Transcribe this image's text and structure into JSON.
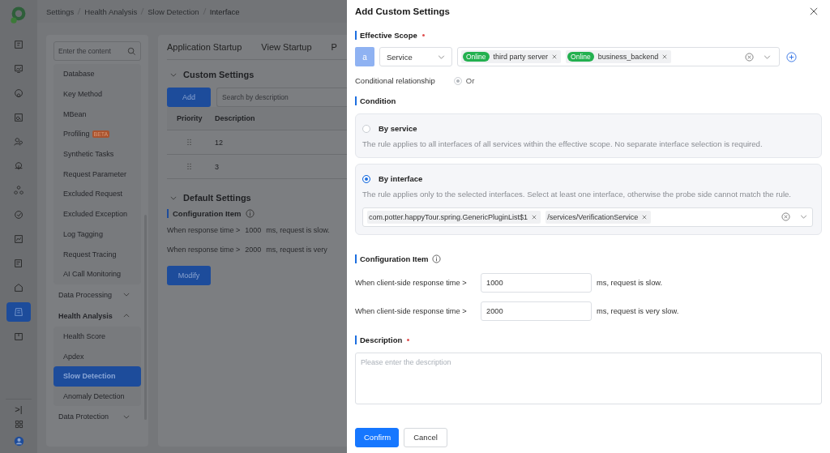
{
  "rail": {
    "icons": [
      {
        "selected": false
      },
      {
        "selected": false
      },
      {
        "selected": false
      },
      {
        "selected": false
      },
      {
        "selected": false
      },
      {
        "selected": false
      },
      {
        "selected": false
      },
      {
        "selected": false
      },
      {
        "selected": false
      },
      {
        "selected": false
      },
      {
        "selected": false
      },
      {
        "selected": true
      },
      {
        "selected": false
      }
    ],
    "collapse": ">|"
  },
  "breadcrumb": [
    "Settings",
    "Health Analysis",
    "Slow Detection",
    "Interface"
  ],
  "sidebar": {
    "search": {
      "placeholder": "Enter the content"
    },
    "items": [
      {
        "label": "Database",
        "selected": false
      },
      {
        "label": "Key Method",
        "selected": false
      },
      {
        "label": "MBean",
        "selected": false
      },
      {
        "label": "Profiling",
        "badge": "BETA",
        "selected": false
      },
      {
        "label": "Synthetic Tasks",
        "selected": false
      },
      {
        "label": "Request Parameter",
        "selected": false
      },
      {
        "label": "Excluded Request",
        "selected": false
      },
      {
        "label": "Excluded Exception",
        "selected": false
      },
      {
        "label": "Log Tagging",
        "selected": false
      },
      {
        "label": "Request Tracing",
        "selected": false
      },
      {
        "label": "AI Call Monitoring",
        "selected": false
      }
    ],
    "groups": [
      {
        "label": "Data Processing",
        "expanded": false
      },
      {
        "label": "Health Analysis",
        "expanded": true,
        "children": [
          {
            "label": "Health Score",
            "selected": false
          },
          {
            "label": "Apdex",
            "selected": false
          },
          {
            "label": "Slow Detection",
            "selected": true
          },
          {
            "label": "Anomaly Detection",
            "selected": false
          }
        ]
      },
      {
        "label": "Data Protection",
        "expanded": false
      }
    ]
  },
  "tabs": [
    {
      "label": "Application Startup"
    },
    {
      "label": "View Startup"
    },
    {
      "label": "P"
    }
  ],
  "custom_settings": {
    "title": "Custom Settings",
    "add_button": "Add",
    "search": {
      "placeholder": "Search by description"
    },
    "columns": [
      "Priority",
      "Description"
    ],
    "rows": [
      {
        "description": "12"
      },
      {
        "description": "3"
      }
    ]
  },
  "default_settings": {
    "title": "Default Settings",
    "config_title": "Configuration Item",
    "lines": [
      {
        "prefix": "When response time >",
        "value": "1000",
        "suffix": "ms, request is slow."
      },
      {
        "prefix": "When response time >",
        "value": "2000",
        "suffix": "ms, request is very"
      }
    ],
    "modify_button": "Modify"
  },
  "drawer": {
    "title": "Add Custom Settings",
    "scope": {
      "title": "Effective Scope",
      "required": true,
      "letter": "a",
      "type": "Service",
      "tags": [
        {
          "status": "Online",
          "name": "third party server"
        },
        {
          "status": "Online",
          "name": "business_backend"
        }
      ],
      "relationship_label": "Conditional relationship",
      "relationship": {
        "label": "Or",
        "selected": true,
        "disabled": true
      }
    },
    "condition": {
      "title": "Condition",
      "options": [
        {
          "title": "By service",
          "text": "The rule applies to all interfaces of all services within the effective scope. No separate interface selection is required.",
          "selected": false
        },
        {
          "title": "By interface",
          "text": "The rule applies only to the selected interfaces. Select at least one interface, otherwise the probe side cannot match the rule.",
          "selected": true,
          "interfaces": [
            "com.potter.happyTour.spring.GenericPluginList$1",
            "/services/VerificationService"
          ]
        }
      ]
    },
    "config": {
      "title": "Configuration Item",
      "lines": [
        {
          "prefix": "When client-side response time >",
          "value": "1000",
          "suffix": "ms, request is slow."
        },
        {
          "prefix": "When client-side response time >",
          "value": "2000",
          "suffix": "ms, request is very slow."
        }
      ]
    },
    "description": {
      "title": "Description",
      "required": true,
      "placeholder": "Please enter the description"
    },
    "buttons": [
      {
        "label": "Confirm",
        "kind": "primary"
      },
      {
        "label": "Cancel",
        "kind": "default"
      }
    ]
  }
}
